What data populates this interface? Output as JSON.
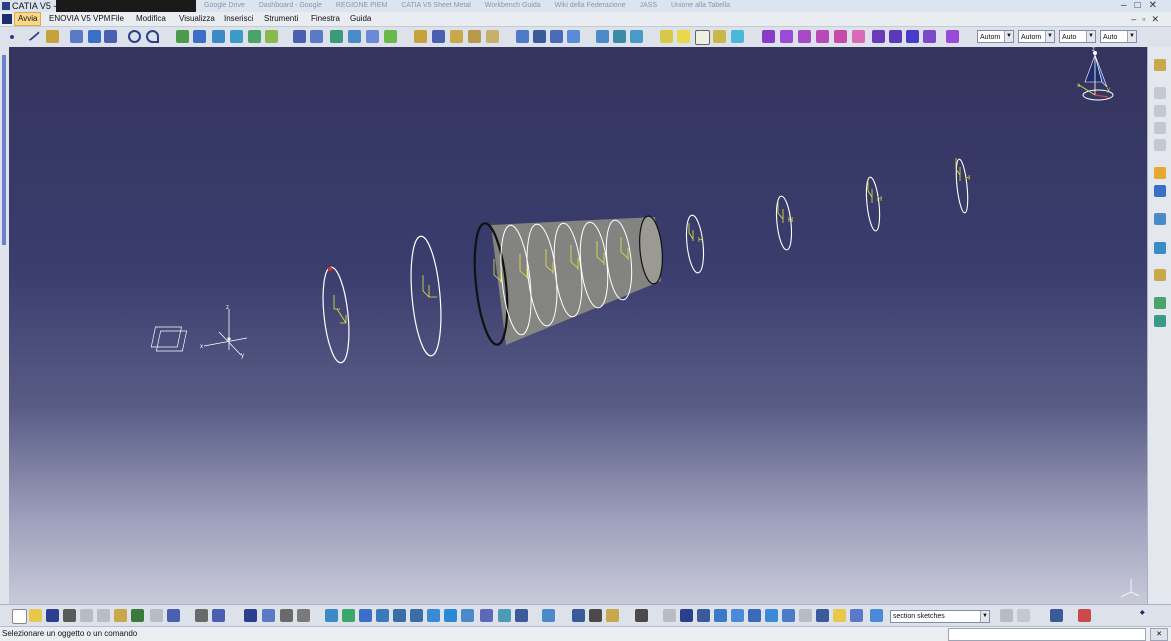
{
  "window": {
    "title": "CATIA V5 - ["
  },
  "background_tabs": [
    "Google Drive",
    "Dashboard - Google",
    "REGIONE PIEM",
    "CATIA V5 Sheet Metal",
    "Workbench Guida",
    "Wiki della Federazione",
    "JASS",
    "Unione alla Tabella"
  ],
  "menubar": {
    "items": [
      {
        "label": "Avvia",
        "active": true
      },
      {
        "label": "ENOVIA V5 VPM",
        "active": false
      },
      {
        "label": "File",
        "active": false
      },
      {
        "label": "Modifica",
        "active": false
      },
      {
        "label": "Visualizza",
        "active": false
      },
      {
        "label": "Inserisci",
        "active": false
      },
      {
        "label": "Strumenti",
        "active": false
      },
      {
        "label": "Finestra",
        "active": false
      },
      {
        "label": "Guida",
        "active": false
      }
    ]
  },
  "toolbar_top": {
    "combos": [
      {
        "value": "Autom"
      },
      {
        "value": "Autom"
      },
      {
        "value": "Auto"
      },
      {
        "value": "Auto"
      }
    ]
  },
  "toolbar_bottom": {
    "section_combo": "section sketches"
  },
  "viewport": {
    "axis_labels": {
      "compass_x": "x",
      "compass_y": "y",
      "compass_z": "z",
      "origin_x": "x",
      "origin_y": "y",
      "origin_z": "z"
    },
    "sketch_axis_v": "V",
    "sketch_axis_h": "H"
  },
  "status_bar": {
    "message": "Selezionare un oggetto o un comando"
  },
  "colors": {
    "viewport_top": "#34345e",
    "viewport_bottom": "#c9cad9",
    "sketch_yellow": "#e6e63c",
    "surface_grey": "#8c8c84",
    "menu_active": "#f6d98a"
  },
  "icons": {
    "catia_logo": "catia-logo-icon",
    "compass": "compass-icon"
  }
}
